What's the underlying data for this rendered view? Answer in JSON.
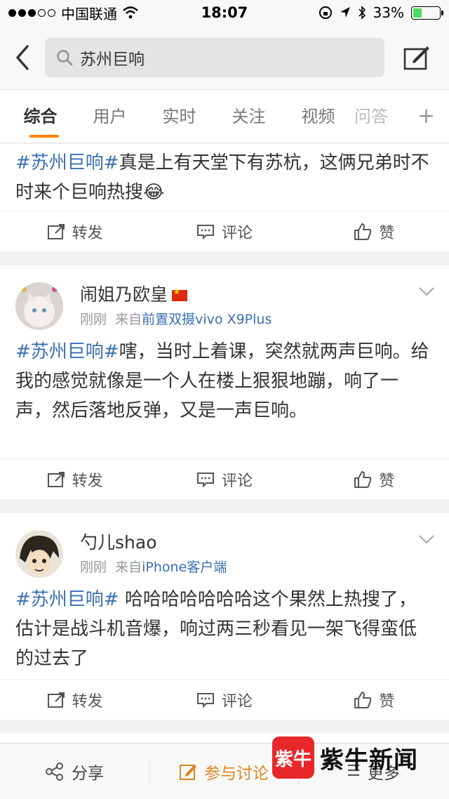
{
  "status_bar": {
    "carrier": "中国联通",
    "time": "18:07",
    "battery": "33%",
    "battery_level": 0.33
  },
  "search": {
    "query": "苏州巨响"
  },
  "tabs": [
    "综合",
    "用户",
    "实时",
    "关注",
    "视频",
    "问答"
  ],
  "tab_add": "+",
  "posts": [
    {
      "hashtag": "#苏州巨响#",
      "text": "真是上有天堂下有苏杭，这俩兄弟时不时来个巨响热搜",
      "emoji": "😂"
    },
    {
      "username": "闹姐乃欧皇",
      "time": "刚刚",
      "source_prefix": "来自",
      "source": "前置双摄vivo X9Plus",
      "hashtag": "#苏州巨响#",
      "text": "嗐，当时上着课，突然就两声巨响。给我的感觉就像是一个人在楼上狠狠地蹦，响了一声，然后落地反弹，又是一声巨响。"
    },
    {
      "username": "勺儿shao",
      "time": "刚刚",
      "source_prefix": "来自",
      "source": "iPhone客户端",
      "hashtag": "#苏州巨响#",
      "text": " 哈哈哈哈哈哈哈这个果然上热搜了，估计是战斗机音爆，响过两三秒看见一架飞得蛮低的过去了"
    }
  ],
  "actions": {
    "repost": "转发",
    "comment": "评论",
    "like": "赞"
  },
  "bottom_bar": {
    "share": "分享",
    "discuss": "参与讨论",
    "more": "更多"
  },
  "watermark": {
    "logo": "紫牛",
    "text": "紫牛新闻"
  },
  "colors": {
    "accent": "#ff8200",
    "link": "#3a6fb5",
    "watermark_red": "#e8272a"
  }
}
